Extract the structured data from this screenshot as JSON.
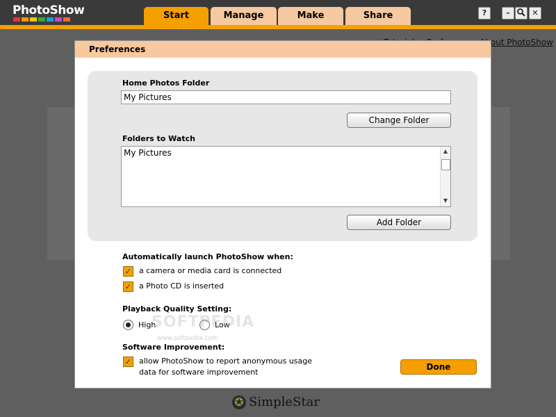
{
  "app": {
    "logo": "PhotoShow",
    "logo_dot_colors": [
      "#e33",
      "#f90",
      "#ec0",
      "#3a3",
      "#29d",
      "#c4c",
      "#f63"
    ]
  },
  "tabs": [
    {
      "label": "Start",
      "active": true
    },
    {
      "label": "Manage",
      "active": false
    },
    {
      "label": "Make",
      "active": false
    },
    {
      "label": "Share",
      "active": false
    }
  ],
  "window_buttons": {
    "help": "?",
    "minimize": "–",
    "search": "🔍",
    "close": "✕"
  },
  "background_links": {
    "tutorials": "Tutorials",
    "preferences": "Preferences",
    "about": "About PhotoShow"
  },
  "dialog": {
    "title": "Preferences",
    "home_folder": {
      "label": "Home Photos Folder",
      "value": "My Pictures",
      "button": "Change Folder"
    },
    "folders_to_watch": {
      "label": "Folders to Watch",
      "items": [
        "My Pictures"
      ],
      "button": "Add Folder"
    },
    "auto_launch": {
      "label": "Automatically launch PhotoShow when:",
      "options": [
        {
          "label": "a camera or media card is connected",
          "checked": true
        },
        {
          "label": "a Photo CD is inserted",
          "checked": true
        }
      ]
    },
    "playback_quality": {
      "label": "Playback Quality Setting:",
      "high": "High",
      "low": "Low",
      "selected": "High"
    },
    "software_improvement": {
      "label": "Software Improvement:",
      "option_line1": "allow PhotoShow to report anonymous usage",
      "option_line2": "data for software improvement",
      "checked": true
    },
    "done_button": "Done"
  },
  "watermark": {
    "text": "SOFTPEDIA",
    "url": "www.softpedia.com"
  },
  "footer": {
    "brand": "SimpleStar"
  },
  "colors": {
    "accent": "#f5a000",
    "dialog_title_bg": "#f8c89f"
  }
}
